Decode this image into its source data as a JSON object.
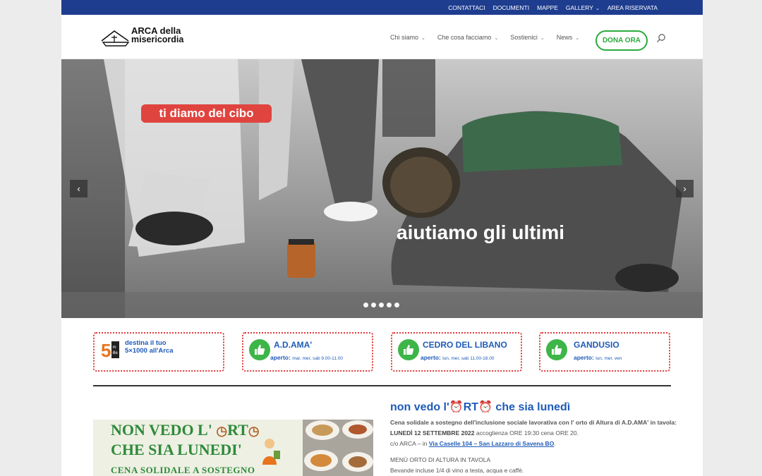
{
  "topnav": {
    "items": [
      {
        "label": "CONTATTACI",
        "dropdown": false
      },
      {
        "label": "DOCUMENTI",
        "dropdown": false
      },
      {
        "label": "MAPPE",
        "dropdown": false
      },
      {
        "label": "GALLERY",
        "dropdown": true
      },
      {
        "label": "AREA RISERVATA",
        "dropdown": false
      }
    ]
  },
  "header": {
    "logo_line1": "ARCA della",
    "logo_line2": "misericordia",
    "nav": [
      {
        "label": "Chi siamo"
      },
      {
        "label": "Che cosa facciamo"
      },
      {
        "label": "Sostienici"
      },
      {
        "label": "News"
      }
    ],
    "cta": "DONA ORA"
  },
  "slider": {
    "tagline": "ti diamo del cibo",
    "headline": "aiutiamo gli ultimi",
    "slides_count": 5
  },
  "boxes": {
    "five": {
      "line1": "destina il tuo",
      "line2": "5×1000 all'Arca"
    },
    "adama": {
      "title": "A.D.AMA'",
      "open_label": "aperto:",
      "hours": "mar, mer, sab 9.00-11.00"
    },
    "cedro": {
      "title": "CEDRO DEL LIBANO",
      "open_label": "aperto:",
      "hours": "lun, mer, sab 11.00-18.00"
    },
    "gandusio": {
      "title": "GANDUSIO",
      "open_label": "aperto:",
      "hours": "lun, mer, ven"
    }
  },
  "promo": {
    "line1": "NON VEDO L' ",
    "line1b": "RT",
    "line2": "CHE SIA LUNEDI'",
    "line3": "CENA SOLIDALE A SOSTEGNO"
  },
  "article": {
    "title_a": "non vedo l'",
    "title_b": "RT",
    "title_c": " che sia lunedì",
    "p1": "Cena solidale a sostegno dell'inclusione sociale lavorativa con l' orto di Altura di A.D.AMA' in tavola:",
    "p2_bold": "LUNEDÌ 12 SETTEMBRE 2022",
    "p2_rest": " accoglienza ORE 19:30 cena ORE 20.",
    "p3_pre": "c/o ARCA – in ",
    "p3_link": "Via Caselle 104 – San Lazzaro di Savena BO",
    "p3_post": ".",
    "p4": "MENÙ ORTO DI ALTURA IN TAVOLA",
    "p5": "Bevande incluse 1/4 di vino a testa, acqua e caffè."
  }
}
